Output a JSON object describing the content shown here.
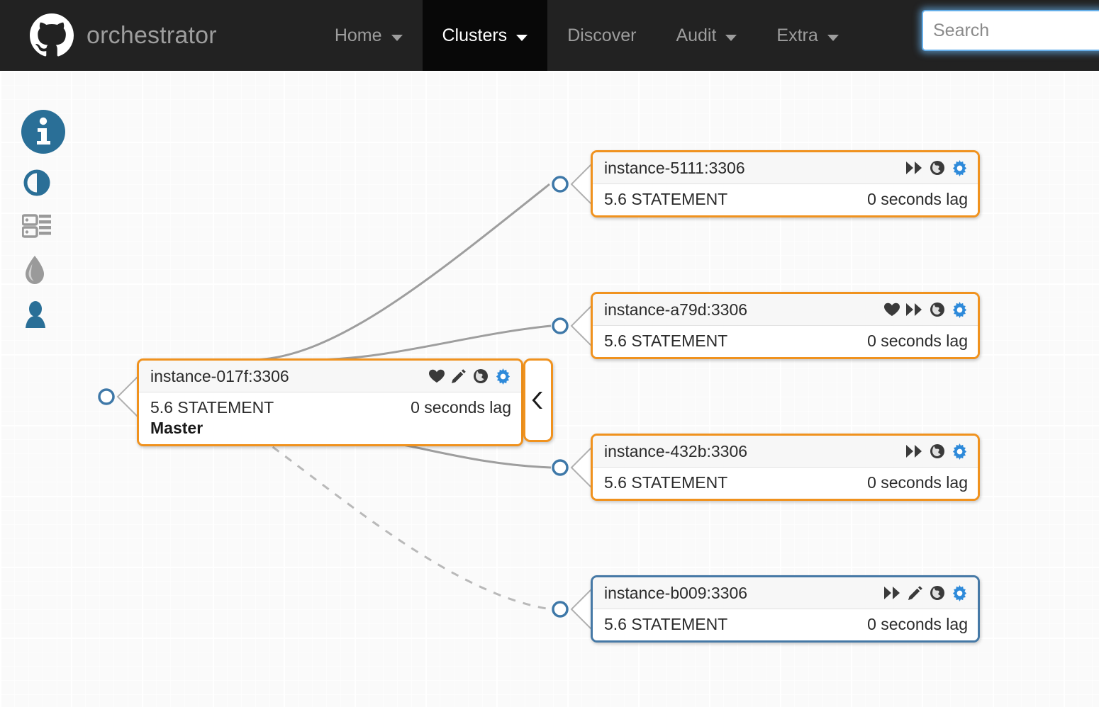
{
  "navbar": {
    "brand": "orchestrator",
    "brand_logo_icon": "github-octocat-icon",
    "items": [
      {
        "label": "Home",
        "icon": "chevron-down-icon",
        "has_caret": true,
        "active": false
      },
      {
        "label": "Clusters",
        "icon": "chevron-down-icon",
        "has_caret": true,
        "active": true
      },
      {
        "label": "Discover",
        "icon": "",
        "has_caret": false,
        "active": false
      },
      {
        "label": "Audit",
        "icon": "chevron-down-icon",
        "has_caret": true,
        "active": false
      },
      {
        "label": "Extra",
        "icon": "chevron-down-icon",
        "has_caret": true,
        "active": false
      }
    ],
    "search": {
      "placeholder": "Search",
      "value": "",
      "focused": true
    }
  },
  "sidebar": {
    "items": [
      {
        "name": "info-icon",
        "title": "Info",
        "color": "#2a6f97",
        "active": true
      },
      {
        "name": "adjust-icon",
        "title": "Adjust",
        "color": "#2a6f97",
        "active": false
      },
      {
        "name": "server-icon",
        "title": "Server",
        "color": "#9a9a9a",
        "active": false
      },
      {
        "name": "tint-icon",
        "title": "Tint",
        "color": "#9a9a9a",
        "active": false
      },
      {
        "name": "user-icon",
        "title": "User",
        "color": "#2a6f97",
        "active": false
      }
    ]
  },
  "colors": {
    "orange_border": "#f0921e",
    "blue_border": "#4679a6",
    "gear_blue": "#2e8ada",
    "icon_dark": "#3a3a3a",
    "connector_ring": "#3e78a8",
    "edge_line": "#9e9e9e",
    "navbar_bg": "#222222",
    "navbar_active_bg": "#080808",
    "canvas_bg": "#fafafa"
  },
  "topology": {
    "collapse_button": {
      "icon": "chevron-left-icon",
      "label": ""
    },
    "nodes": [
      {
        "id": "master",
        "title": "instance-017f:3306",
        "version": "5.6 STATEMENT",
        "lag": "0 seconds lag",
        "role": "Master",
        "border": "orange",
        "icons": [
          "heart-icon",
          "pencil-icon",
          "globe-icon",
          "gear-icon"
        ]
      },
      {
        "id": "replica-5111",
        "title": "instance-5111:3306",
        "version": "5.6 STATEMENT",
        "lag": "0 seconds lag",
        "role": "",
        "border": "orange",
        "icons": [
          "fast-forward-icon",
          "globe-icon",
          "gear-icon"
        ]
      },
      {
        "id": "replica-a79d",
        "title": "instance-a79d:3306",
        "version": "5.6 STATEMENT",
        "lag": "0 seconds lag",
        "role": "",
        "border": "orange",
        "icons": [
          "heart-icon",
          "fast-forward-icon",
          "globe-icon",
          "gear-icon"
        ]
      },
      {
        "id": "replica-432b",
        "title": "instance-432b:3306",
        "version": "5.6 STATEMENT",
        "lag": "0 seconds lag",
        "role": "",
        "border": "orange",
        "icons": [
          "fast-forward-icon",
          "globe-icon",
          "gear-icon"
        ]
      },
      {
        "id": "replica-b009",
        "title": "instance-b009:3306",
        "version": "5.6 STATEMENT",
        "lag": "0 seconds lag",
        "role": "",
        "border": "blue",
        "icons": [
          "fast-forward-icon",
          "pencil-icon",
          "globe-icon",
          "gear-icon"
        ]
      }
    ],
    "edges": [
      {
        "from": "master",
        "to": "replica-5111",
        "style": "solid"
      },
      {
        "from": "master",
        "to": "replica-a79d",
        "style": "solid"
      },
      {
        "from": "master",
        "to": "replica-432b",
        "style": "solid"
      },
      {
        "from": "master",
        "to": "replica-b009",
        "style": "dashed"
      }
    ]
  }
}
